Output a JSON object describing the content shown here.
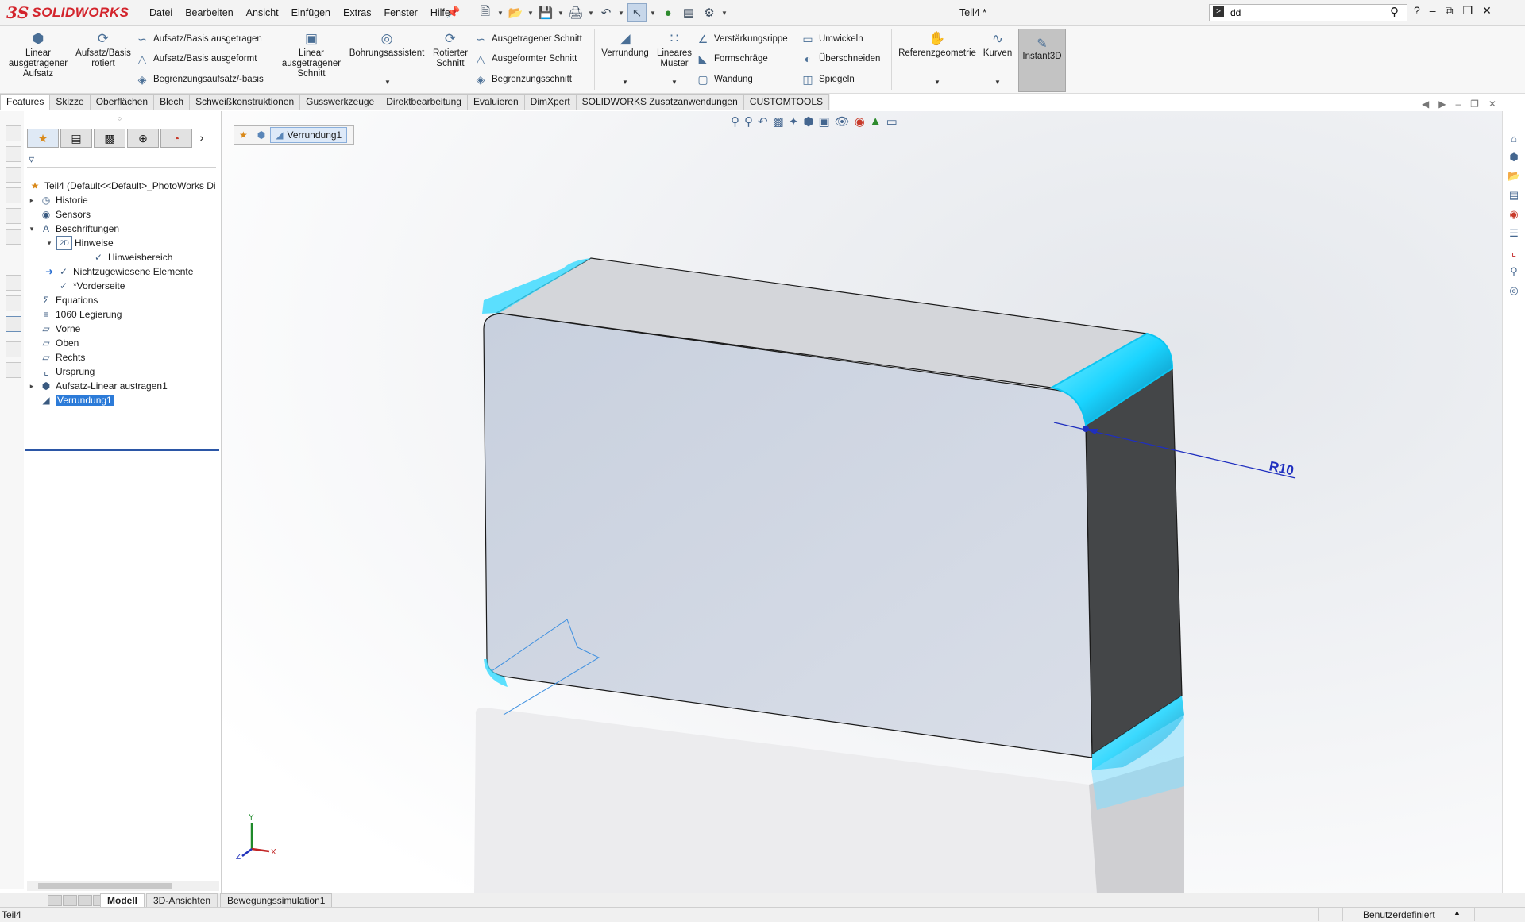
{
  "app": {
    "brand_ds": "3S",
    "brand_name": "SOLIDWORKS",
    "doc_title": "Teil4 *"
  },
  "menus": [
    "Datei",
    "Bearbeiten",
    "Ansicht",
    "Einfügen",
    "Extras",
    "Fenster",
    "Hilfe"
  ],
  "search": {
    "value": "dd"
  },
  "commands": {
    "linear_extrude": "Linear ausgetragener Aufsatz",
    "revolve": "Aufsatz/Basis rotiert",
    "sweep": "Aufsatz/Basis ausgetragen",
    "loft": "Aufsatz/Basis ausgeformt",
    "boundary": "Begrenzungsaufsatz/-basis",
    "cut_extrude": "Linear ausgetragener Schnitt",
    "hole_wizard": "Bohrungsassistent",
    "revolve_cut": "Rotierter Schnitt",
    "swept_cut": "Ausgetragener Schnitt",
    "lofted_cut": "Ausgeformter Schnitt",
    "boundary_cut": "Begrenzungsschnitt",
    "fillet": "Verrundung",
    "linear_pattern": "Lineares Muster",
    "rib": "Verstärkungsrippe",
    "draft": "Formschräge",
    "shell": "Wandung",
    "wrap": "Umwickeln",
    "intersect": "Überschneiden",
    "mirror": "Spiegeln",
    "ref_geometry": "Referenzgeometrie",
    "curves": "Kurven",
    "instant3d": "Instant3D"
  },
  "tabs": [
    "Features",
    "Skizze",
    "Oberflächen",
    "Blech",
    "Schweißkonstruktionen",
    "Gusswerkzeuge",
    "Direktbearbeitung",
    "Evaluieren",
    "DimXpert",
    "SOLIDWORKS Zusatzanwendungen",
    "CUSTOMTOOLS"
  ],
  "tree": {
    "root": "Teil4  (Default<<Default>_PhotoWorks Di",
    "items": [
      {
        "label": "Historie"
      },
      {
        "label": "Sensors"
      },
      {
        "label": "Beschriftungen"
      },
      {
        "label": "Hinweise"
      },
      {
        "label": "Hinweisbereich"
      },
      {
        "label": "Nichtzugewiesene Elemente"
      },
      {
        "label": "*Vorderseite"
      },
      {
        "label": "Equations"
      },
      {
        "label": "1060 Legierung"
      },
      {
        "label": "Vorne"
      },
      {
        "label": "Oben"
      },
      {
        "label": "Rechts"
      },
      {
        "label": "Ursprung"
      },
      {
        "label": "Aufsatz-Linear austragen1"
      },
      {
        "label": "Verrundung1"
      }
    ]
  },
  "breadcrumb": {
    "current": "Verrundung1"
  },
  "dimension": {
    "label": "R10"
  },
  "triad": {
    "x": "X",
    "y": "Y",
    "z": "Z"
  },
  "bottom_tabs": [
    "Modell",
    "3D-Ansichten",
    "Bewegungssimulation1"
  ],
  "status": {
    "left": "Teil4",
    "right": "Benutzerdefiniert"
  },
  "colors": {
    "brand": "#d3242c",
    "selection": "#2c7bd8",
    "highlight_edge": "#19d4ff",
    "dimension": "#1f2fbf"
  }
}
